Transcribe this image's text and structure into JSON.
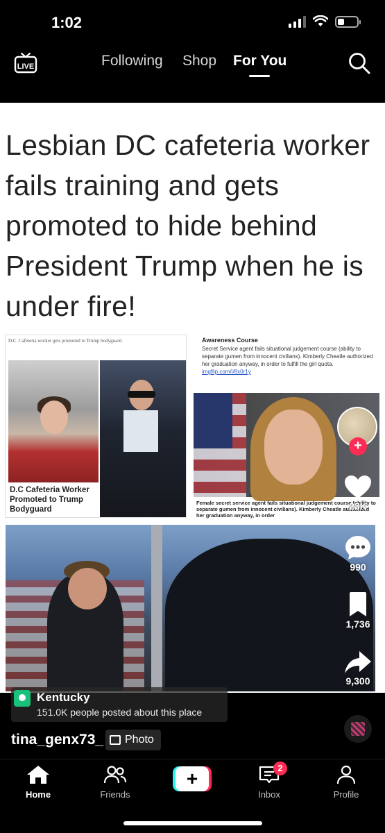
{
  "status_bar": {
    "time": "1:02"
  },
  "top_nav": {
    "live_label": "LIVE",
    "tabs": [
      {
        "label": "Following",
        "active": false
      },
      {
        "label": "Shop",
        "active": false
      },
      {
        "label": "For You",
        "active": true
      }
    ]
  },
  "post": {
    "headline": "Lesbian DC cafeteria worker fails training and gets promoted to hide behind President Trump when he is under fire!",
    "left_panel": {
      "caption": "D.C. Cafeteria worker gets promoted to Trump bodyguard.",
      "label": "D.C Cafeteria Worker Promoted to Trump Bodyguard"
    },
    "right_panel": {
      "heading": "Awareness Course",
      "text": "Secret Service agent fails situational judgement course (ability to separate gumen from innocent civilians). Kimberly Cheatle authorized her graduation anyway, in order to fulfill the girl quota.",
      "link": "imgflip.com/i/8x0r1y",
      "photo_caption": "Female secret service agent fails situational judgement course (ability to separate gumen from innocent civilians). Kimberly Cheatle authorized her graduation anyway, in order"
    }
  },
  "actions": {
    "likes": "23K",
    "comments": "990",
    "saves": "1,736",
    "shares": "9,300"
  },
  "location": {
    "name": "Kentucky",
    "subtitle": "151.0K people posted about this place"
  },
  "author": {
    "username": "tina_genx73_",
    "media_type": "Photo"
  },
  "bottom_nav": {
    "home": "Home",
    "friends": "Friends",
    "inbox": "Inbox",
    "inbox_badge": "2",
    "profile": "Profile"
  },
  "colors": {
    "accent_red": "#fe2c55",
    "accent_cyan": "#25f4ee",
    "location_green": "#19c27a"
  }
}
